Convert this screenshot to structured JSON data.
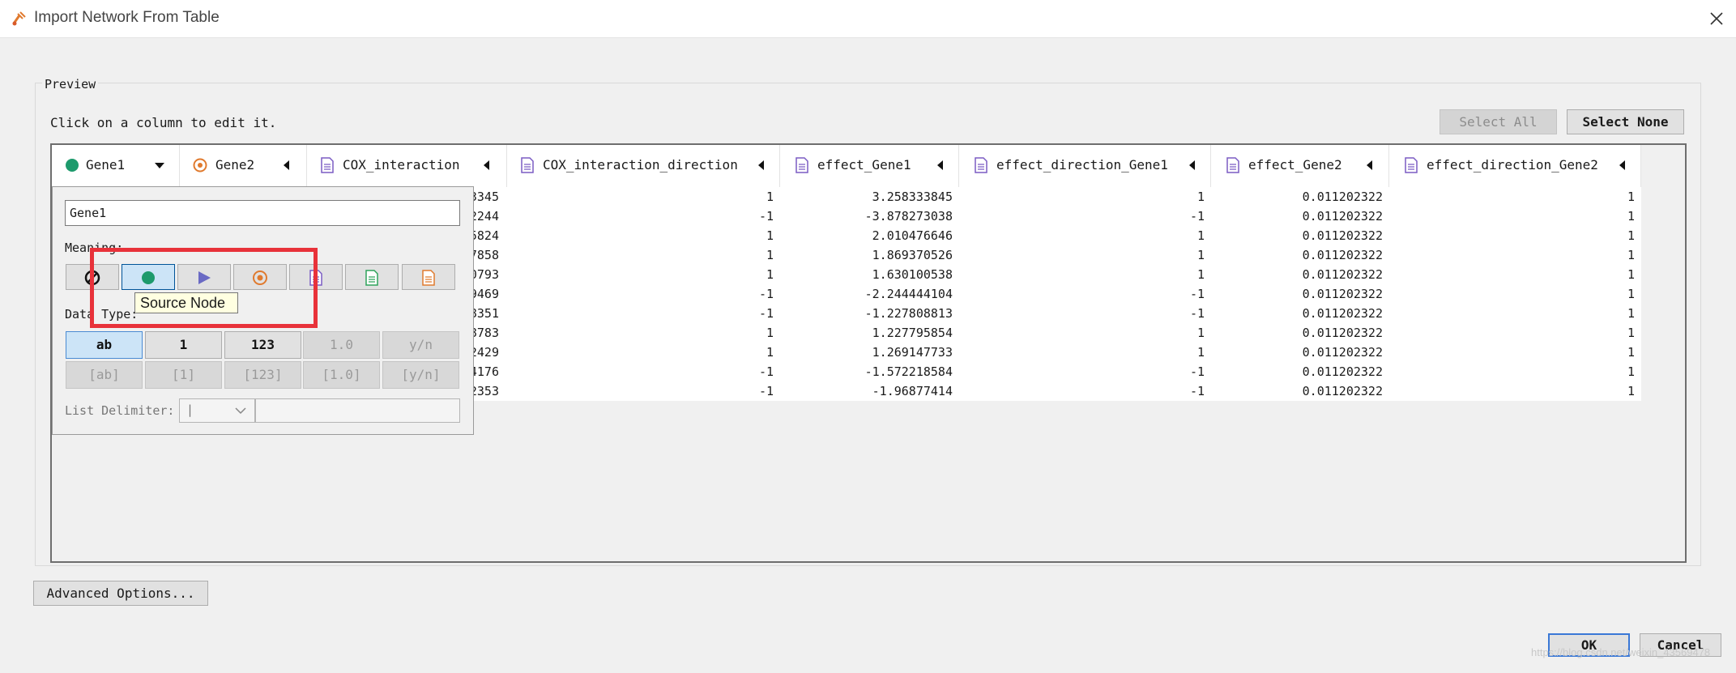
{
  "window": {
    "title": "Import Network From Table"
  },
  "preview": {
    "legend": "Preview",
    "hint": "Click on a column to edit it.",
    "select_all": "Select All",
    "select_none": "Select None"
  },
  "columns": [
    {
      "name": "Gene1",
      "icon": "source-node-icon"
    },
    {
      "name": "Gene2",
      "icon": "target-node-icon"
    },
    {
      "name": "COX_interaction",
      "icon": "edge-attribute-icon"
    },
    {
      "name": "COX_interaction_direction",
      "icon": "edge-attribute-icon"
    },
    {
      "name": "effect_Gene1",
      "icon": "edge-attribute-icon"
    },
    {
      "name": "effect_direction_Gene1",
      "icon": "edge-attribute-icon"
    },
    {
      "name": "effect_Gene2",
      "icon": "edge-attribute-icon"
    },
    {
      "name": "effect_direction_Gene2",
      "icon": "edge-attribute-icon"
    }
  ],
  "rows": [
    {
      "cox": "3345",
      "dir": "1",
      "e1": "3.258333845",
      "d1": "1",
      "e2": "0.011202322",
      "d2": "1"
    },
    {
      "cox": "2244",
      "dir": "-1",
      "e1": "-3.878273038",
      "d1": "-1",
      "e2": "0.011202322",
      "d2": "1"
    },
    {
      "cox": "5824",
      "dir": "1",
      "e1": "2.010476646",
      "d1": "1",
      "e2": "0.011202322",
      "d2": "1"
    },
    {
      "cox": "7858",
      "dir": "1",
      "e1": "1.869370526",
      "d1": "1",
      "e2": "0.011202322",
      "d2": "1"
    },
    {
      "cox": "0793",
      "dir": "1",
      "e1": "1.630100538",
      "d1": "1",
      "e2": "0.011202322",
      "d2": "1"
    },
    {
      "cox": "9469",
      "dir": "-1",
      "e1": "-2.244444104",
      "d1": "-1",
      "e2": "0.011202322",
      "d2": "1"
    },
    {
      "cox": "8351",
      "dir": "-1",
      "e1": "-1.227808813",
      "d1": "-1",
      "e2": "0.011202322",
      "d2": "1"
    },
    {
      "cox": "8783",
      "dir": "1",
      "e1": "1.227795854",
      "d1": "1",
      "e2": "0.011202322",
      "d2": "1"
    },
    {
      "cox": "2429",
      "dir": "1",
      "e1": "1.269147733",
      "d1": "1",
      "e2": "0.011202322",
      "d2": "1"
    },
    {
      "cox": "4176",
      "dir": "-1",
      "e1": "-1.572218584",
      "d1": "-1",
      "e2": "0.011202322",
      "d2": "1"
    },
    {
      "cox": "2353",
      "dir": "-1",
      "e1": "-1.96877414",
      "d1": "-1",
      "e2": "0.011202322",
      "d2": "1"
    }
  ],
  "editor": {
    "column_name": "Gene1",
    "meaning_label": "Meaning:",
    "data_type_label": "Data Type:",
    "tooltip": "Source Node",
    "types": [
      "ab",
      "1",
      "123",
      "1.0",
      "y/n"
    ],
    "list_types": [
      "[ab]",
      "[1]",
      "[123]",
      "[1.0]",
      "[y/n]"
    ],
    "list_delimiter_label": "List Delimiter:",
    "list_delimiter_value": "|"
  },
  "footer": {
    "advanced_options": "Advanced Options...",
    "ok": "OK",
    "cancel": "Cancel",
    "watermark": "https://blog.csdn.net/weixin_43569478"
  },
  "colors": {
    "source": "#1d9a6c",
    "target": "#e07a2e",
    "edge_attr": "#7b5cc4",
    "node_attr": "#2ea35a",
    "highlight": "#e8323a",
    "play": "#6a6ac4"
  }
}
